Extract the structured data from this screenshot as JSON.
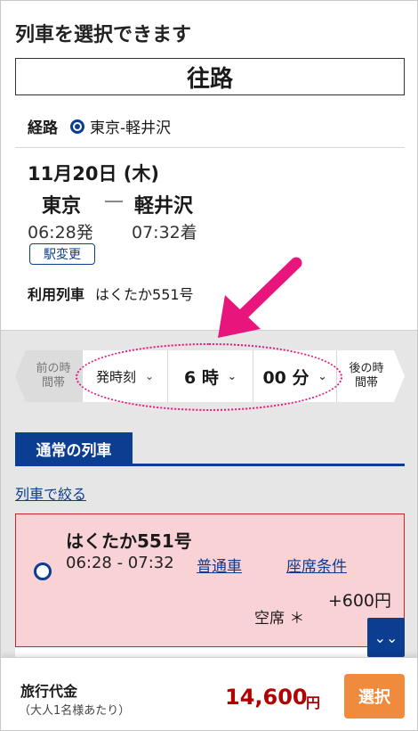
{
  "header": {
    "title": "列車を選択できます"
  },
  "trip": {
    "direction": "往路"
  },
  "route": {
    "label": "経路",
    "value": "東京-軽井沢"
  },
  "journey": {
    "date": "11月20日 (木)",
    "from_station": "東京",
    "to_station": "軽井沢",
    "departure": "06:28発",
    "arrival": "07:32着",
    "change_station_label": "駅変更"
  },
  "train_info": {
    "label": "利用列車",
    "value": "はくたか551号"
  },
  "time_selector": {
    "prev_label": "前の時間帯",
    "kind": "発時刻",
    "hour": "6 時",
    "minute": "00 分",
    "next_label": "後の時間帯"
  },
  "tabs": {
    "active": "通常の列車"
  },
  "filter": {
    "label": "列車で絞る"
  },
  "result": {
    "name": "はくたか551号",
    "time": "06:28 ‐ 07:32",
    "car_class": "普通車",
    "seat_conditions": "座席条件",
    "extra_charge": "+600円",
    "availability": "空席 ＊"
  },
  "footer": {
    "fare_label": "旅行代金",
    "fare_note": "（大人1名様あたり）",
    "amount": "14,600",
    "unit": "円",
    "select_label": "選択"
  },
  "colors": {
    "brand": "#0b3d91",
    "highlight": "#e8157c",
    "price": "#b30000",
    "cta": "#f08a3c",
    "card_bg": "#f9d2d6"
  }
}
